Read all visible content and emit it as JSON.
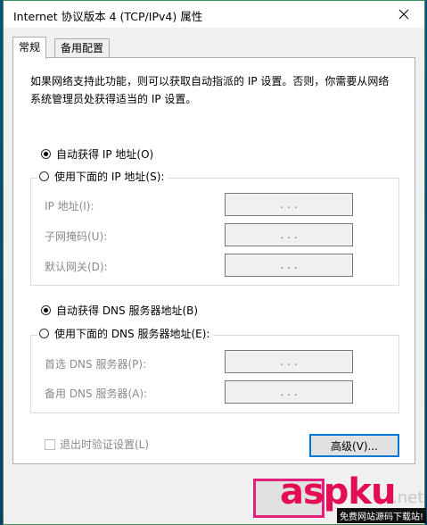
{
  "window": {
    "title": "Internet 协议版本 4 (TCP/IPv4) 属性"
  },
  "tabs": [
    {
      "label": "常规",
      "active": true
    },
    {
      "label": "备用配置",
      "active": false
    }
  ],
  "description": "如果网络支持此功能，则可以获取自动指派的 IP 设置。否则，你需要从网络系统管理员处获得适当的 IP 设置。",
  "ip": {
    "auto_label": "自动获得 IP 地址(O)",
    "manual_label": "使用下面的 IP 地址(S):",
    "selected": "auto",
    "fields": [
      {
        "label": "IP 地址(I):",
        "value": ". . ."
      },
      {
        "label": "子网掩码(U):",
        "value": ". . ."
      },
      {
        "label": "默认网关(D):",
        "value": ". . ."
      }
    ]
  },
  "dns": {
    "auto_label": "自动获得 DNS 服务器地址(B)",
    "manual_label": "使用下面的 DNS 服务器地址(E):",
    "selected": "auto",
    "fields": [
      {
        "label": "首选 DNS 服务器(P):",
        "value": ". . ."
      },
      {
        "label": "备用 DNS 服务器(A):",
        "value": ". . ."
      }
    ]
  },
  "validate_label": "退出时验证设置(L)",
  "advanced_label": "高级(V)...",
  "watermark": {
    "brand": "aspku",
    "suffix": ".net",
    "tagline": "免费网站源码下载站!"
  },
  "colors": {
    "accent": "#0078d7",
    "highlight": "#e0207c",
    "watermark": "#e30d52"
  }
}
